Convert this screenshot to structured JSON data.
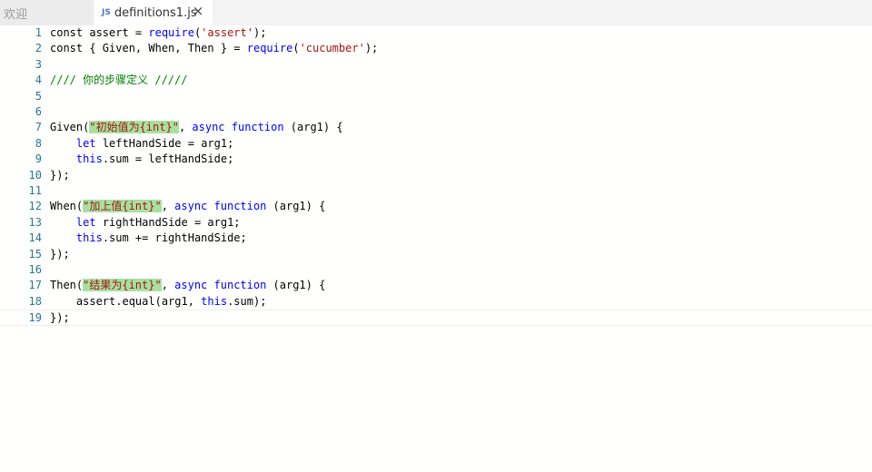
{
  "tabs": {
    "welcome_label": "欢迎",
    "active_icon": "JS",
    "active_label": "definitions1.js",
    "close_glyph": "×"
  },
  "lines": [
    [
      {
        "t": "const assert = ",
        "c": ""
      },
      {
        "t": "require",
        "c": "kw"
      },
      {
        "t": "(",
        "c": ""
      },
      {
        "t": "'assert'",
        "c": "str"
      },
      {
        "t": ");",
        "c": ""
      }
    ],
    [
      {
        "t": "const { Given, When, Then } = ",
        "c": ""
      },
      {
        "t": "require",
        "c": "kw"
      },
      {
        "t": "(",
        "c": ""
      },
      {
        "t": "'cucumber'",
        "c": "str"
      },
      {
        "t": ");",
        "c": ""
      }
    ],
    [],
    [
      {
        "t": "//// 你的步骤定义 /////",
        "c": "cmt"
      }
    ],
    [],
    [],
    [
      {
        "t": "Given(",
        "c": ""
      },
      {
        "t": "\"初始值为{int}\"",
        "c": "str hl"
      },
      {
        "t": ", ",
        "c": ""
      },
      {
        "t": "async",
        "c": "kw"
      },
      {
        "t": " ",
        "c": ""
      },
      {
        "t": "function",
        "c": "kw"
      },
      {
        "t": " (arg1) {",
        "c": ""
      }
    ],
    [
      {
        "t": "    ",
        "c": ""
      },
      {
        "t": "let",
        "c": "kw"
      },
      {
        "t": " leftHandSide = arg1;",
        "c": ""
      }
    ],
    [
      {
        "t": "    ",
        "c": ""
      },
      {
        "t": "this",
        "c": "kw"
      },
      {
        "t": ".sum = leftHandSide;",
        "c": ""
      }
    ],
    [
      {
        "t": "});",
        "c": ""
      }
    ],
    [],
    [
      {
        "t": "When(",
        "c": ""
      },
      {
        "t": "\"加上值{int}\"",
        "c": "str hl"
      },
      {
        "t": ", ",
        "c": ""
      },
      {
        "t": "async",
        "c": "kw"
      },
      {
        "t": " ",
        "c": ""
      },
      {
        "t": "function",
        "c": "kw"
      },
      {
        "t": " (arg1) {",
        "c": ""
      }
    ],
    [
      {
        "t": "    ",
        "c": ""
      },
      {
        "t": "let",
        "c": "kw"
      },
      {
        "t": " rightHandSide = arg1;",
        "c": ""
      }
    ],
    [
      {
        "t": "    ",
        "c": ""
      },
      {
        "t": "this",
        "c": "kw"
      },
      {
        "t": ".sum += rightHandSide;",
        "c": ""
      }
    ],
    [
      {
        "t": "});",
        "c": ""
      }
    ],
    [],
    [
      {
        "t": "Then(",
        "c": ""
      },
      {
        "t": "\"结果为{int}\"",
        "c": "str hl"
      },
      {
        "t": ", ",
        "c": ""
      },
      {
        "t": "async",
        "c": "kw"
      },
      {
        "t": " ",
        "c": ""
      },
      {
        "t": "function",
        "c": "kw"
      },
      {
        "t": " (arg1) {",
        "c": ""
      }
    ],
    [
      {
        "t": "    assert.equal(arg1, ",
        "c": ""
      },
      {
        "t": "this",
        "c": "kw"
      },
      {
        "t": ".sum);",
        "c": ""
      }
    ],
    [
      {
        "t": "});",
        "c": ""
      }
    ]
  ],
  "line_numbers": [
    "1",
    "2",
    "3",
    "4",
    "5",
    "6",
    "7",
    "8",
    "9",
    "10",
    "11",
    "12",
    "13",
    "14",
    "15",
    "16",
    "17",
    "18",
    "19"
  ],
  "current_line": 19,
  "colors": {
    "keyword": "#0000ff",
    "string": "#a31515",
    "comment": "#008000",
    "line_number": "#237893",
    "highlight": "#a8e0a0"
  }
}
